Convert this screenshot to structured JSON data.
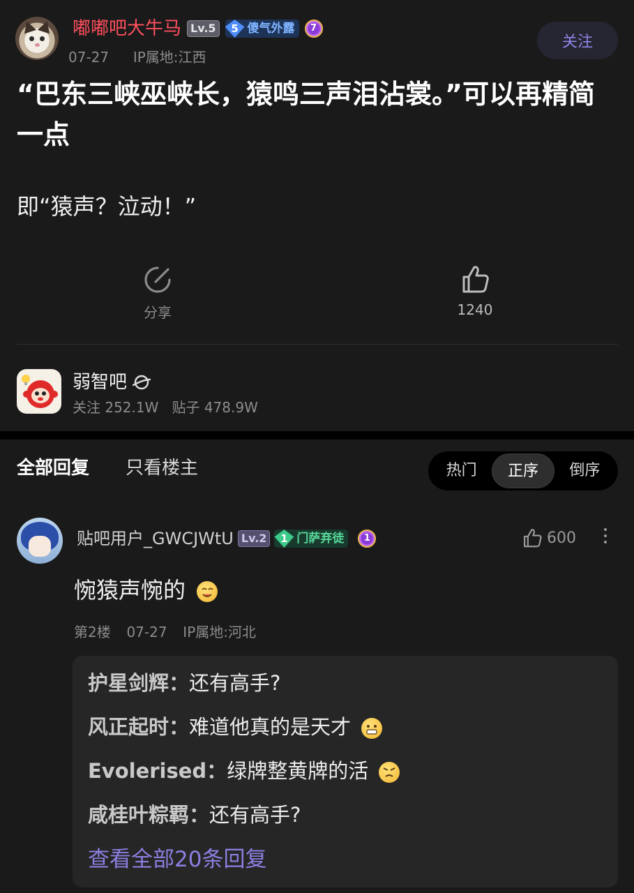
{
  "post": {
    "author": {
      "name": "嘟嘟吧大牛马",
      "level": "Lv.5",
      "title_level": "5",
      "title": "傻气外露",
      "medal": "7",
      "date": "07-27",
      "ip": "IP属地:江西"
    },
    "follow_label": "关注",
    "title": "“巴东三峡巫峡长，猿鸣三声泪沾裳。”可以再精简一点",
    "body": "即“猿声？泣动！”",
    "actions": {
      "share_label": "分享",
      "like_count": "1240"
    }
  },
  "forum": {
    "name": "弱智吧",
    "stats": "关注 252.1W   贴子 478.9W"
  },
  "replies_header": {
    "tab_all": "全部回复",
    "tab_op_only": "只看楼主",
    "sort_options": [
      "热门",
      "正序",
      "倒序"
    ],
    "active_sort": "正序"
  },
  "reply": {
    "author": "贴吧用户_GWCJWtU",
    "level": "Lv.2",
    "title_level": "1",
    "title": "门萨弃徒",
    "medal": "1",
    "likes": "600",
    "text": "惋猿声惋的",
    "floor": "第2楼",
    "date": "07-27",
    "ip": "IP属地:河北",
    "subreplies": [
      {
        "author": "护星剑辉：",
        "text": "还有高手?"
      },
      {
        "author": "风正起时：",
        "text": "难道他真的是天才"
      },
      {
        "author": "Evolerised：",
        "text": "绿牌整黄牌的活"
      },
      {
        "author": "咸桂叶粽羁：",
        "text": "还有高手?"
      }
    ],
    "view_all_label": "查看全部20条回复"
  },
  "colors": {
    "background": "#1a1a1a",
    "username_red": "#ff4f5e",
    "accent_purple": "#8a7fe0",
    "muted_text": "#8c8c8c"
  }
}
